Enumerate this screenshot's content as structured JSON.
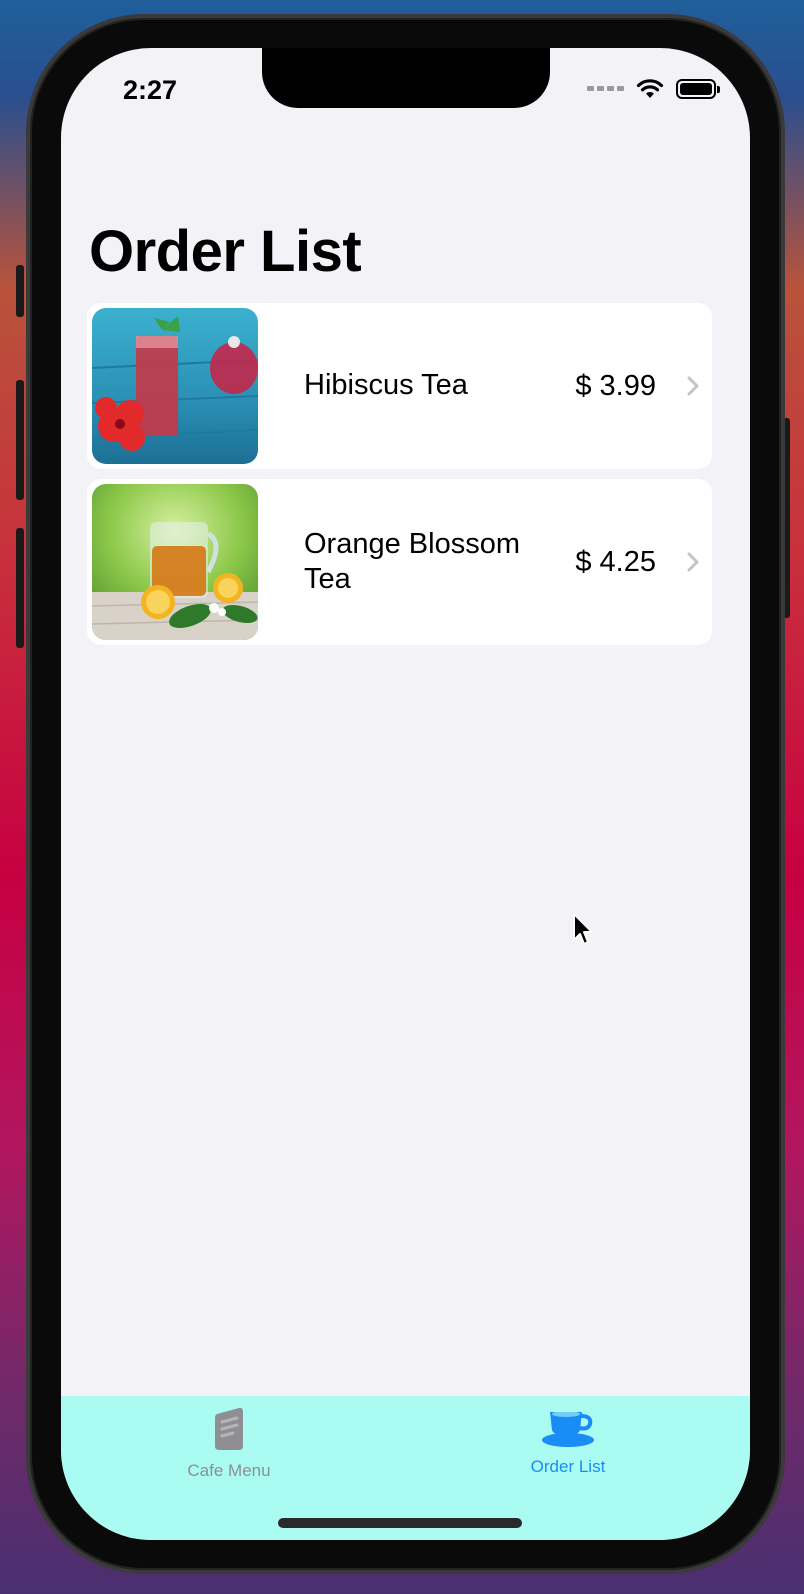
{
  "status_bar": {
    "time": "2:27"
  },
  "page": {
    "title": "Order List"
  },
  "orders": [
    {
      "name": "Hibiscus Tea",
      "price": "$ 3.99",
      "image": "hibiscus-tea-photo"
    },
    {
      "name": "Orange Blossom Tea",
      "price": "$ 4.25",
      "image": "orange-blossom-tea-photo"
    }
  ],
  "tabbar": {
    "background": "#aafcf3",
    "tabs": [
      {
        "label": "Cafe Menu",
        "icon": "book-icon",
        "selected": false
      },
      {
        "label": "Order List",
        "icon": "coffee-cup-icon",
        "selected": true
      }
    ]
  },
  "colors": {
    "accent": "#1a8cf5",
    "screen_bg": "#f2f2f7",
    "inactive_tab": "#8e8e93"
  }
}
